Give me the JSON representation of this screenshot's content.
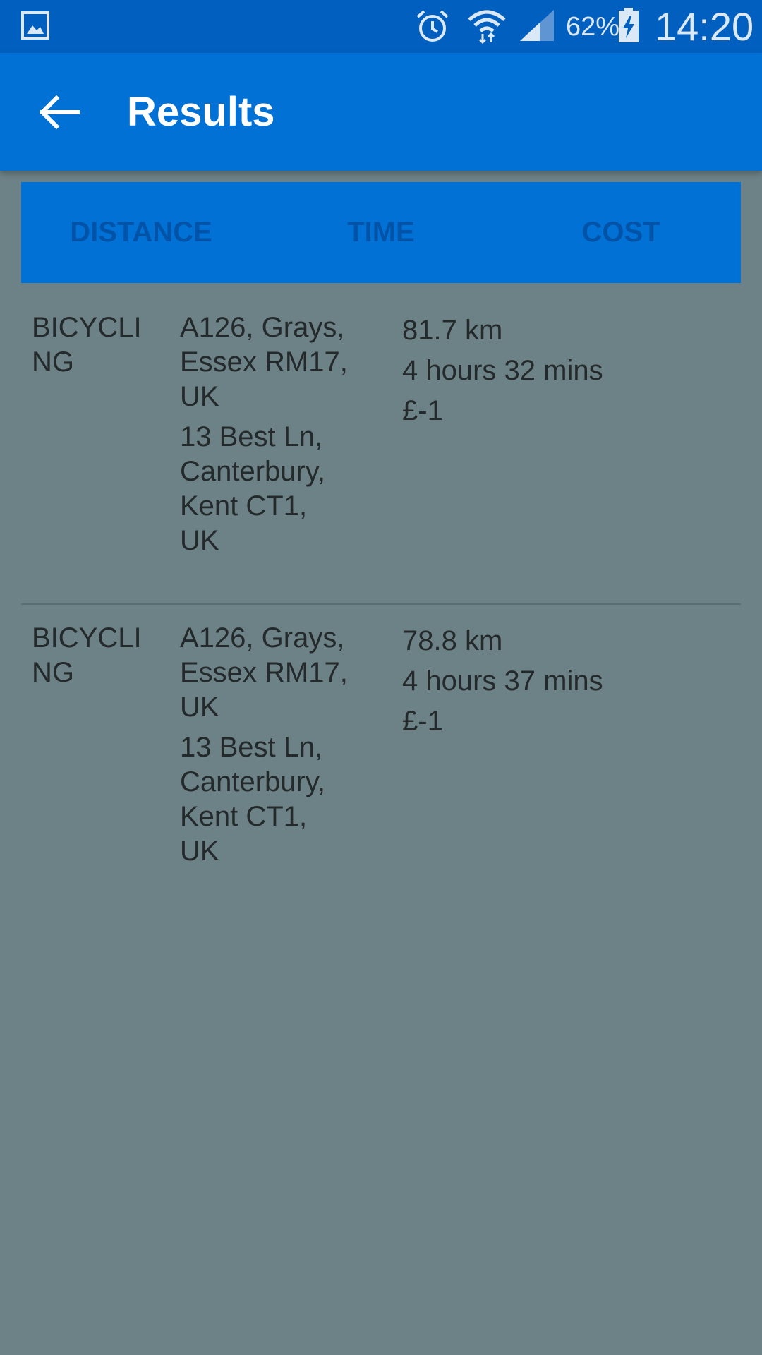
{
  "status_bar": {
    "battery_percent": "62%",
    "time": "14:20",
    "icons": [
      "gallery-icon",
      "alarm-icon",
      "wifi-icon",
      "signal-icon",
      "battery-charging-icon"
    ]
  },
  "app_bar": {
    "title": "Results",
    "back_icon": "arrow-back-icon"
  },
  "sort_tabs": [
    {
      "label": "DISTANCE"
    },
    {
      "label": "TIME"
    },
    {
      "label": "COST"
    }
  ],
  "results": [
    {
      "mode": "BICYCLING",
      "origin": "A126, Grays, Essex RM17, UK",
      "destination": "13 Best Ln, Canterbury, Kent CT1, UK",
      "distance": "81.7 km",
      "time": "4 hours 32 mins",
      "cost": "£-1"
    },
    {
      "mode": "BICYCLING",
      "origin": "A126, Grays, Essex RM17, UK",
      "destination": "13 Best Ln, Canterbury, Kent CT1, UK",
      "distance": "78.8 km",
      "time": "4 hours 37 mins",
      "cost": "£-1"
    }
  ],
  "colors": {
    "status_bar": "#0160bf",
    "app_bar": "#0171d5",
    "tab_text": "#0153a7",
    "background": "#6c8286"
  }
}
